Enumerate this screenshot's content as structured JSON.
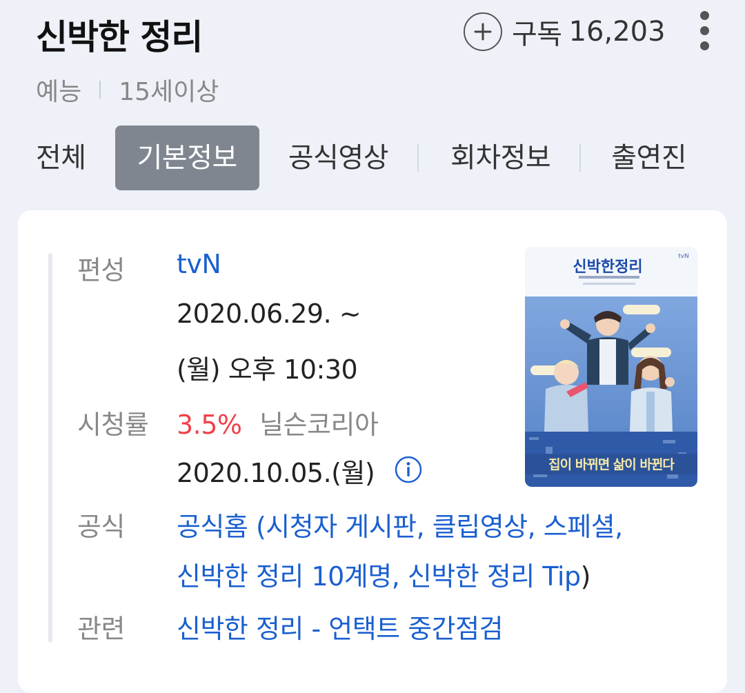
{
  "header": {
    "title": "신박한 정리",
    "subscribe_label": "구독",
    "subscribe_count": "16,203"
  },
  "meta": {
    "genre": "예능",
    "rating_age": "15세이상"
  },
  "tabs": [
    {
      "label": "전체",
      "active": false
    },
    {
      "label": "기본정보",
      "active": true
    },
    {
      "label": "공식영상",
      "active": false
    },
    {
      "label": "회차정보",
      "active": false
    },
    {
      "label": "출연진",
      "active": false
    }
  ],
  "info": {
    "broadcast_label": "편성",
    "broadcaster": "tvN",
    "start_date": "2020.06.29. ~",
    "air_time": "(월) 오후 10:30",
    "rating_label": "시청률",
    "rating_value": "3.5%",
    "rating_source": "닐슨코리아",
    "rating_date": "2020.10.05.(월)",
    "official_label": "공식",
    "official_line1_link": "공식홈",
    "official_line1_open": " (",
    "official_links_line1": "시청자 게시판, 클립영상, 스페셜,",
    "official_links_line2": "신박한 정리 10계명, 신박한 정리 Tip",
    "official_close": ")",
    "related_label": "관련",
    "related_link": "신박한 정리 - 언택트 중간점검"
  },
  "poster": {
    "title_text": "신박한정리",
    "bottom_text": "집이 바뀌면 삶이 바뀐다",
    "channel": "tvN"
  },
  "colors": {
    "background": "#eef1f7",
    "link": "#1a5fd0",
    "rating": "#f0414b",
    "active_tab": "#808690"
  },
  "icons": {
    "subscribe": "plus-circle-icon",
    "more": "more-vertical-icon",
    "info": "info-icon"
  }
}
